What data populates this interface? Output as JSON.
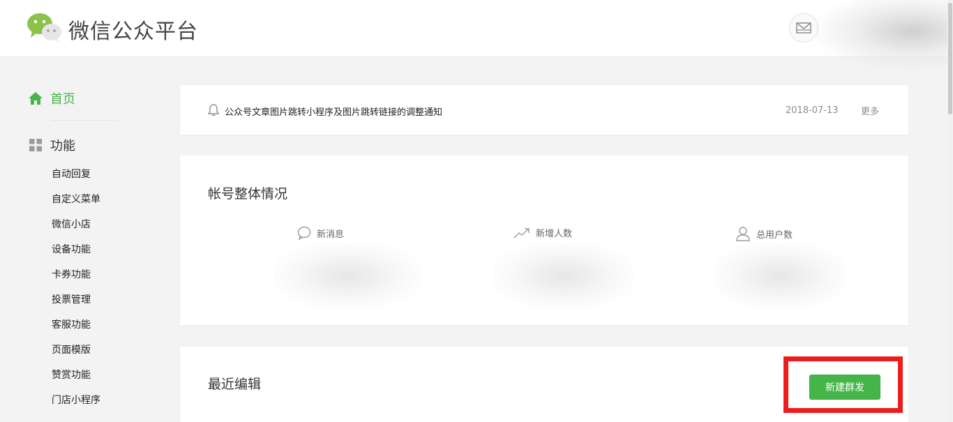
{
  "header": {
    "brand": "微信公众平台",
    "mail_icon": "mail-icon",
    "logo_icon": "wechat-logo-icon"
  },
  "sidebar": {
    "home": {
      "label": "首页",
      "icon": "home-icon"
    },
    "features": {
      "label": "功能",
      "icon": "grid-icon"
    },
    "items": [
      {
        "label": "自动回复"
      },
      {
        "label": "自定义菜单"
      },
      {
        "label": "微信小店"
      },
      {
        "label": "设备功能"
      },
      {
        "label": "卡券功能"
      },
      {
        "label": "投票管理"
      },
      {
        "label": "客服功能"
      },
      {
        "label": "页面模版"
      },
      {
        "label": "赞赏功能"
      },
      {
        "label": "门店小程序"
      }
    ]
  },
  "notice": {
    "icon": "bell-icon",
    "text": "公众号文章图片跳转小程序及图片跳转链接的调整通知",
    "date": "2018-07-13",
    "more": "更多"
  },
  "overview": {
    "title": "帐号整体情况",
    "stats": [
      {
        "label": "新消息",
        "icon": "chat-bubble-icon"
      },
      {
        "label": "新增人数",
        "icon": "trend-up-icon"
      },
      {
        "label": "总用户数",
        "icon": "user-icon"
      }
    ]
  },
  "recent": {
    "title": "最近编辑",
    "new_button": "新建群发"
  },
  "colors": {
    "accent": "#44b549",
    "highlight": "#ee1c1c",
    "background": "#f3f3f3"
  }
}
